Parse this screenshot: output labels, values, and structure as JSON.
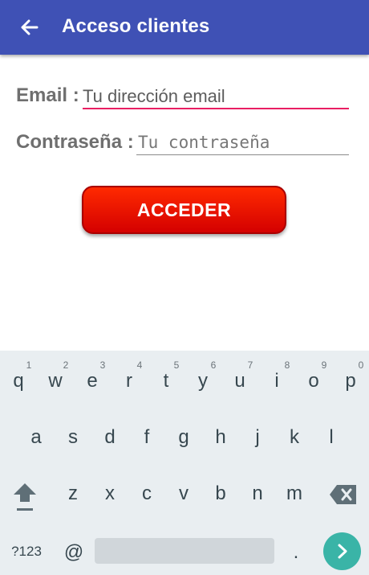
{
  "app_bar": {
    "title": "Acceso clientes"
  },
  "form": {
    "email_label": "Email :",
    "email_placeholder": "Tu dirección email",
    "password_label": "Contraseña :",
    "password_placeholder": "Tu contraseña",
    "submit_label": "ACCEDER"
  },
  "keyboard": {
    "row1": [
      "q",
      "w",
      "e",
      "r",
      "t",
      "y",
      "u",
      "i",
      "o",
      "p"
    ],
    "row1_hints": [
      "1",
      "2",
      "3",
      "4",
      "5",
      "6",
      "7",
      "8",
      "9",
      "0"
    ],
    "row2": [
      "a",
      "s",
      "d",
      "f",
      "g",
      "h",
      "j",
      "k",
      "l"
    ],
    "row3": [
      "z",
      "x",
      "c",
      "v",
      "b",
      "n",
      "m"
    ],
    "symbols_label": "?123",
    "at_label": "@",
    "period_label": "."
  },
  "colors": {
    "app_bar": "#3f51b5",
    "button": "#e81000",
    "email_underline": "#e91e63",
    "enter": "#3ab4a7"
  }
}
